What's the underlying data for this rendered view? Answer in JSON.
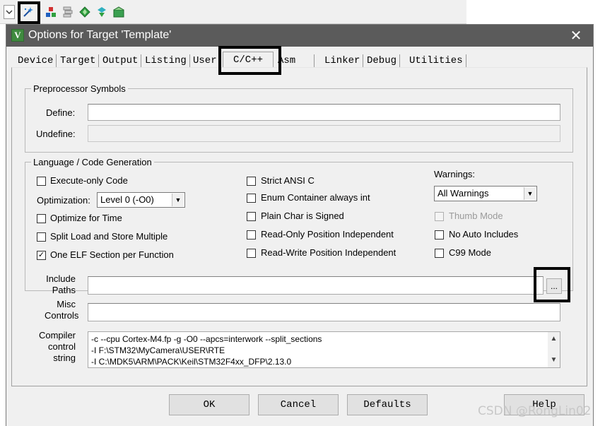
{
  "dialog": {
    "title": "Options for Target 'Template'",
    "close_glyph": "✕",
    "icon_letter": "V"
  },
  "tabs": [
    {
      "label": "Device"
    },
    {
      "label": "Target"
    },
    {
      "label": "Output"
    },
    {
      "label": "Listing"
    },
    {
      "label": "User"
    },
    {
      "label": "C/C++",
      "active": true
    },
    {
      "label": "Asm"
    },
    {
      "label": "Linker"
    },
    {
      "label": "Debug"
    },
    {
      "label": "Utilities"
    }
  ],
  "preprocessor": {
    "legend": "Preprocessor Symbols",
    "define_label": "Define:",
    "define_value": "",
    "undefine_label": "Undefine:",
    "undefine_value": ""
  },
  "language": {
    "legend": "Language / Code Generation",
    "execute_only": "Execute-only Code",
    "optimization_label": "Optimization:",
    "optimization_value": "Level 0 (-O0)",
    "optimize_time": "Optimize for Time",
    "split_load": "Split Load and Store Multiple",
    "one_elf": "One ELF Section per Function",
    "one_elf_check": "✓",
    "strict_ansi": "Strict ANSI C",
    "enum_container": "Enum Container always int",
    "plain_char": "Plain Char is Signed",
    "ro_pos": "Read-Only Position Independent",
    "rw_pos": "Read-Write Position Independent",
    "warnings_label": "Warnings:",
    "warnings_value": "All Warnings",
    "thumb_mode": "Thumb Mode",
    "no_auto_includes": "No Auto Includes",
    "c99_mode": "C99 Mode"
  },
  "include": {
    "label_line1": "Include",
    "label_line2": "Paths",
    "value": "",
    "browse_label": "..."
  },
  "misc": {
    "label_line1": "Misc",
    "label_line2": "Controls",
    "value": ""
  },
  "compiler": {
    "label_line1": "Compiler",
    "label_line2": "control",
    "label_line3": "string",
    "lines": [
      "-c --cpu Cortex-M4.fp -g -O0 --apcs=interwork --split_sections",
      "-I F:\\STM32\\MyCamera\\USER\\RTE",
      "-I C:\\MDK5\\ARM\\PACK\\Keil\\STM32F4xx_DFP\\2.13.0"
    ]
  },
  "buttons": {
    "ok": "OK",
    "cancel": "Cancel",
    "defaults": "Defaults",
    "help": "Help"
  },
  "watermark": "CSDN @RongLin02",
  "colors": {
    "titlebar": "#5b5b5b",
    "dialog_bg": "#f0f0f0",
    "highlight": "#000000"
  },
  "toolbar_icons": [
    "dropdown-icon",
    "magic-wand-icon",
    "component-icon",
    "stack-icon",
    "diamond-icon",
    "run-icon",
    "package-icon"
  ]
}
